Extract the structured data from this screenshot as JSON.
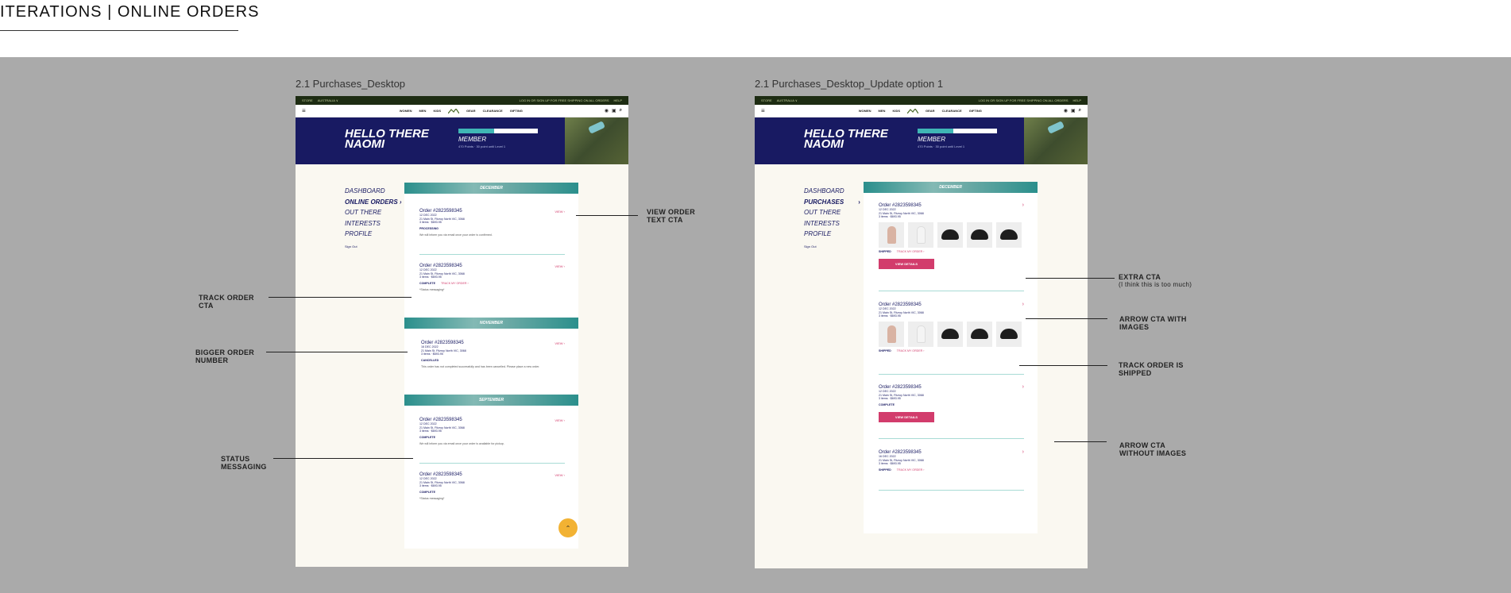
{
  "page": {
    "title": "ITERATIONS | ONLINE ORDERS"
  },
  "frames": [
    {
      "label": "2.1 Purchases_Desktop",
      "topbar": {
        "store": "STORE",
        "region": "AUSTRALIA ∨",
        "promo": "LOG IN OR SIGN UP FOR FREE SHIPPING ON ALL ORDERS",
        "help": "HELP"
      },
      "nav": [
        "WOMEN",
        "MEN",
        "KIDS",
        "GEAR",
        "CLEARANCE",
        "GIFTING"
      ],
      "hero": {
        "greeting_line1": "HELLO THERE",
        "greeting_line2": "NAOMI",
        "tier": "MEMBER",
        "points": "470 Points · 30 point until Level 1",
        "progress": 0.45
      },
      "sidenav": {
        "items": [
          "DASHBOARD",
          "ONLINE ORDERS ›",
          "OUT THERE",
          "INTERESTS",
          "PROFILE"
        ],
        "signout": "Sign Out"
      },
      "months": [
        {
          "name": "DECEMBER",
          "orders": [
            {
              "number": "Order #2823598345",
              "date": "12 DEC 2022",
              "address": "21 Main St, Fitzroy North VIC, 3068",
              "summary": "3 items · $693.95",
              "status": "PROCESSING",
              "track": "",
              "message": "We will inform you via email once your order is confirmed.",
              "cta": "VIEW ›"
            },
            {
              "number": "Order #2823598345",
              "date": "12 DEC 2022",
              "address": "21 Main St, Fitzroy North VIC, 3068",
              "summary": "3 items · $693.95",
              "status": "COMPLETE",
              "track": "TRACK MY ORDER ›",
              "message": "*Status messaging*",
              "cta": "VIEW ›"
            }
          ]
        },
        {
          "name": "NOVEMBER",
          "orders": [
            {
              "number": "Order #2823598345",
              "date": "16 DEC 2022",
              "address": "21 Main St, Fitzroy North VIC, 3068",
              "summary": "3 items · $693.95",
              "status": "CANCELLED",
              "track": "",
              "message": "This order has not completed successfully and has been cancelled. Please place a new order.",
              "cta": "VIEW ›"
            }
          ]
        },
        {
          "name": "SEPTEMBER",
          "orders": [
            {
              "number": "Order #2823598345",
              "date": "12 DEC 2022",
              "address": "21 Main St, Fitzroy North VIC, 3068",
              "summary": "3 items · $693.95",
              "status": "COMPLETE",
              "track": "",
              "message": "We will inform you via email once your order is available for pickup.",
              "cta": "VIEW ›"
            },
            {
              "number": "Order #2823598345",
              "date": "12 DEC 2022",
              "address": "21 Main St, Fitzroy North VIC, 3068",
              "summary": "3 items · $693.95",
              "status": "COMPLETE",
              "track": "",
              "message": "*Status messaging*",
              "cta": "VIEW ›"
            }
          ]
        }
      ],
      "fab": "⌃"
    },
    {
      "label": "2.1 Purchases_Desktop_Update option 1",
      "topbar": {
        "store": "STORE",
        "region": "AUSTRALIA ∨",
        "promo": "LOG IN OR SIGN UP FOR FREE SHIPPING ON ALL ORDERS",
        "help": "HELP"
      },
      "nav": [
        "WOMEN",
        "MEN",
        "KIDS",
        "GEAR",
        "CLEARANCE",
        "GIFTING"
      ],
      "hero": {
        "greeting_line1": "HELLO THERE",
        "greeting_line2": "NAOMI",
        "tier": "MEMBER",
        "points": "470 Points · 30 point until Level 1",
        "progress": 0.45
      },
      "sidenav": {
        "items": [
          "DASHBOARD",
          "PURCHASES",
          "OUT THERE",
          "INTERESTS",
          "PROFILE"
        ],
        "signout": "Sign Out"
      },
      "months": [
        {
          "name": "DECEMBER",
          "orders": [
            {
              "number": "Order #2823598345",
              "date": "12 DEC 2022",
              "address": "21 Main St, Fitzroy North VIC, 3068",
              "summary": "3 items · $693.95",
              "status": "SHIPPED",
              "track": "TRACK MY ORDER ›",
              "images": true,
              "details": "VIEW DETAILS",
              "cta": "›"
            },
            {
              "number": "Order #2823598345",
              "date": "12 DEC 2022",
              "address": "21 Main St, Fitzroy North VIC, 3068",
              "summary": "3 items · $693.95",
              "status": "SHIPPED",
              "track": "TRACK MY ORDER ›",
              "images": true,
              "details": "",
              "cta": "›"
            },
            {
              "number": "Order #2823598345",
              "date": "12 DEC 2022",
              "address": "21 Main St, Fitzroy North VIC, 3068",
              "summary": "3 items · $693.95",
              "status": "COMPLETE",
              "track": "",
              "images": false,
              "details": "VIEW DETAILS",
              "cta": "›"
            },
            {
              "number": "Order #2823598345",
              "date": "16 DEC 2022",
              "address": "21 Main St, Fitzroy North VIC, 3068",
              "summary": "3 items · $693.95",
              "status": "SHIPPED",
              "track": "TRACK MY ORDER ›",
              "images": false,
              "details": "",
              "cta": "›"
            }
          ]
        }
      ]
    }
  ],
  "annotations": {
    "view_order_cta": [
      "VIEW ORDER",
      "TEXT CTA"
    ],
    "track_order_cta": [
      "TRACK ORDER",
      "CTA"
    ],
    "bigger_order_number": [
      "BIGGER ORDER",
      "NUMBER"
    ],
    "status_messaging": [
      "STATUS",
      "MESSAGING"
    ],
    "extra_cta": [
      "EXTRA CTA",
      "(I think this is too much)"
    ],
    "arrow_cta_images": [
      "ARROW CTA WITH",
      "IMAGES"
    ],
    "track_order_shipped": [
      "TRACK ORDER IS",
      "SHIPPED"
    ],
    "arrow_cta_no_images": [
      "ARROW CTA",
      "WITHOUT IMAGES"
    ]
  },
  "colors": {
    "navy": "#181a62",
    "accent": "#d23c6c",
    "teal": "#2b8f8c",
    "topbar": "#1d2c12",
    "fab": "#f2b233",
    "canvas": "#aaaaaa"
  }
}
